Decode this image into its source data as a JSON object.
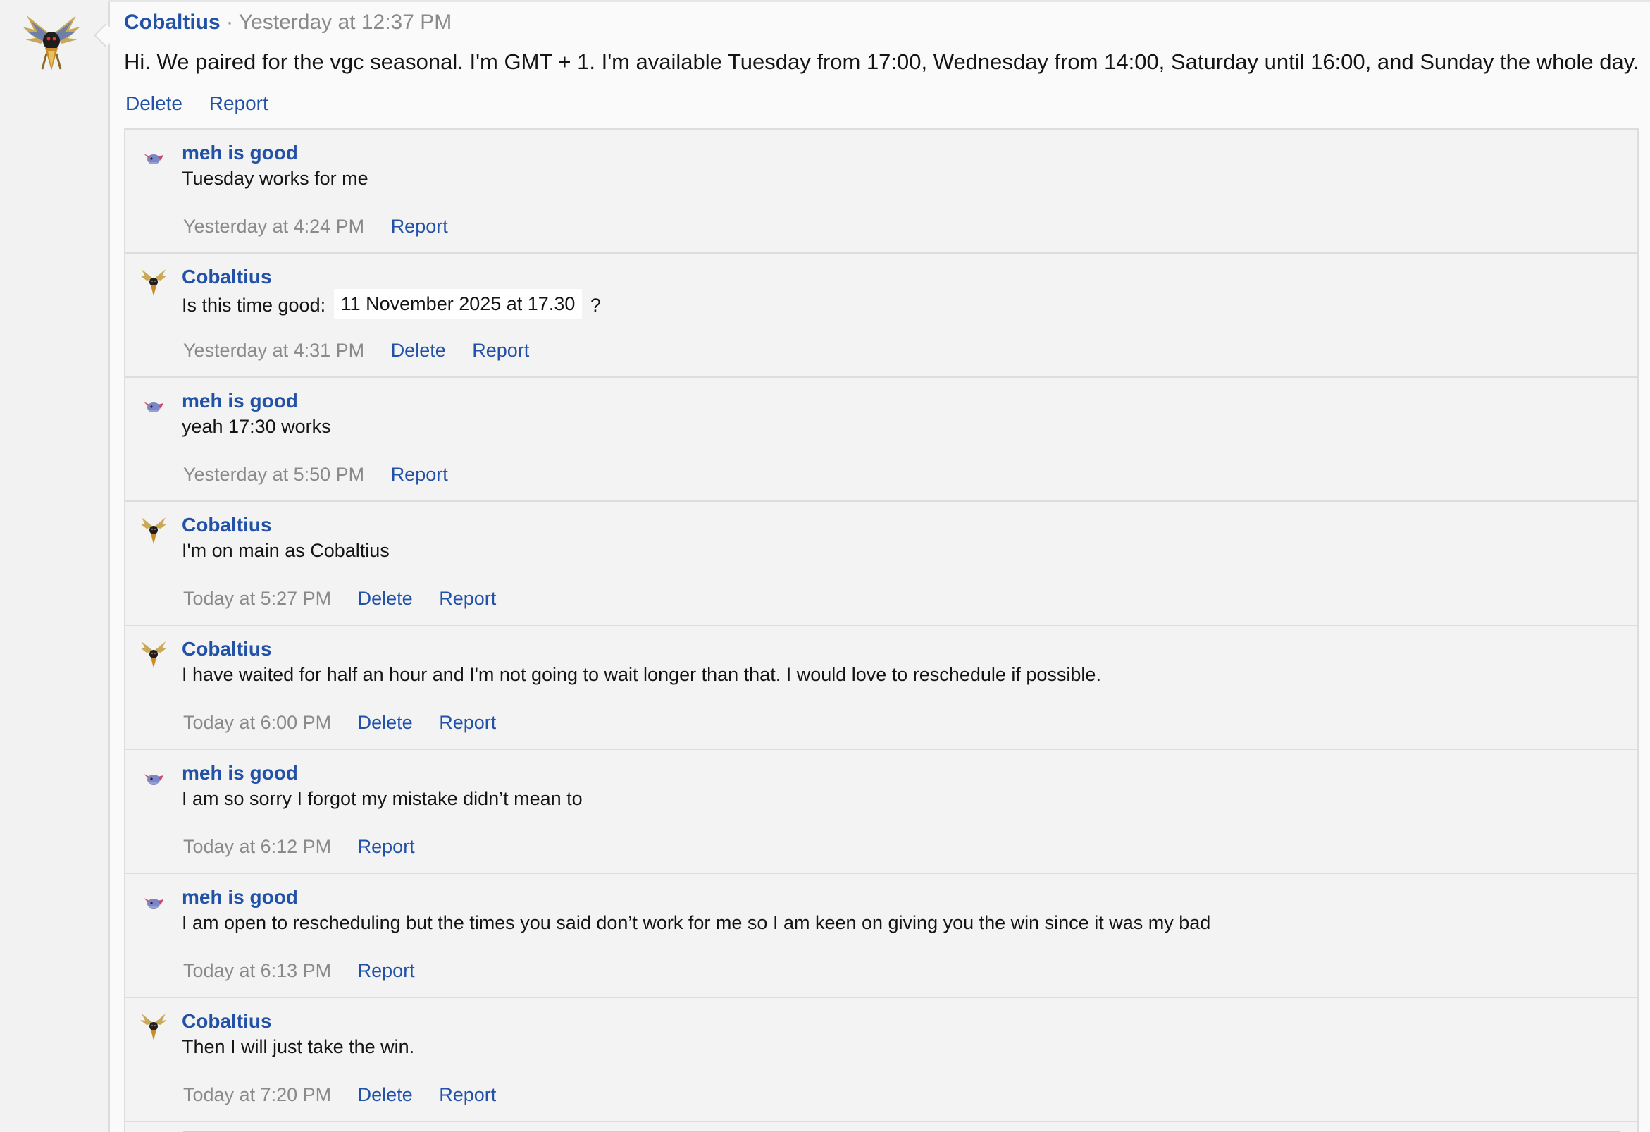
{
  "post": {
    "author": "Cobaltius",
    "separator": "·",
    "timestamp": "Yesterday at 12:37 PM",
    "body": "Hi. We paired for the vgc seasonal. I'm GMT + 1. I'm available Tuesday from 17:00, Wednesday from 14:00, Saturday until 16:00, and Sunday the whole day.",
    "actions": {
      "delete": "Delete",
      "report": "Report"
    },
    "avatar_icon": "winged-pokemon-avatar-icon"
  },
  "comments": [
    {
      "author": "meh is good",
      "text": "Tuesday works for me",
      "time": "Yesterday at 4:24 PM",
      "report": "Report",
      "avatar_icon": "small-creature-avatar-icon"
    },
    {
      "author": "Cobaltius",
      "text_before": "Is this time good:",
      "date_chip": "11 November 2025 at 17.30",
      "text_after": "?",
      "time": "Yesterday at 4:31 PM",
      "delete": "Delete",
      "report": "Report",
      "avatar_icon": "winged-pokemon-avatar-icon"
    },
    {
      "author": "meh is good",
      "text": "yeah 17:30 works",
      "time": "Yesterday at 5:50 PM",
      "report": "Report",
      "avatar_icon": "small-creature-avatar-icon"
    },
    {
      "author": "Cobaltius",
      "text": "I'm on main as Cobaltius",
      "time": "Today at 5:27 PM",
      "delete": "Delete",
      "report": "Report",
      "avatar_icon": "winged-pokemon-avatar-icon"
    },
    {
      "author": "Cobaltius",
      "text": "I have waited for half an hour and I'm not going to wait longer than that. I would love to reschedule if possible.",
      "time": "Today at 6:00 PM",
      "delete": "Delete",
      "report": "Report",
      "avatar_icon": "winged-pokemon-avatar-icon"
    },
    {
      "author": "meh is good",
      "text": "I am so sorry I forgot my mistake didn’t mean to",
      "time": "Today at 6:12 PM",
      "report": "Report",
      "avatar_icon": "small-creature-avatar-icon"
    },
    {
      "author": "meh is good",
      "text": "I am open to rescheduling but the times you said don’t work for me so I am keen on giving you the win since it was my bad",
      "time": "Today at 6:13 PM",
      "report": "Report",
      "avatar_icon": "small-creature-avatar-icon"
    },
    {
      "author": "Cobaltius",
      "text": "Then I will just take the win.",
      "time": "Today at 7:20 PM",
      "delete": "Delete",
      "report": "Report",
      "avatar_icon": "winged-pokemon-avatar-icon"
    }
  ],
  "colors": {
    "link": "#2251a8",
    "muted": "#8a8a8a",
    "comments_bg": "#f3f3f3",
    "rail_bg": "#f2f2f2"
  }
}
